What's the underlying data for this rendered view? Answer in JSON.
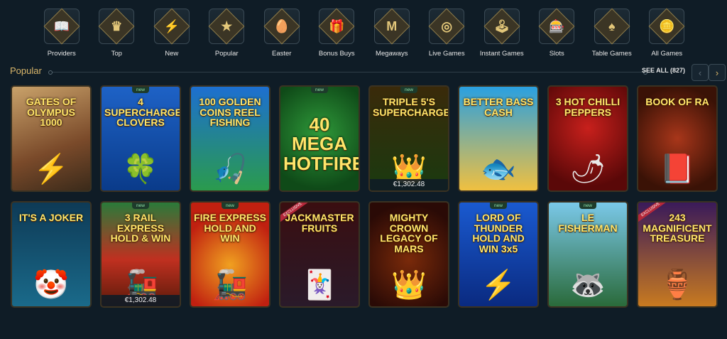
{
  "categories": [
    {
      "label": "Providers",
      "glyph": "📖"
    },
    {
      "label": "Top",
      "glyph": "♛"
    },
    {
      "label": "New",
      "glyph": "⚡"
    },
    {
      "label": "Popular",
      "glyph": "★"
    },
    {
      "label": "Easter",
      "glyph": "🥚"
    },
    {
      "label": "Bonus Buys",
      "glyph": "🎁"
    },
    {
      "label": "Megaways",
      "glyph": "M"
    },
    {
      "label": "Live Games",
      "glyph": "◎"
    },
    {
      "label": "Instant Games",
      "glyph": "🕹"
    },
    {
      "label": "Slots",
      "glyph": "🎰"
    },
    {
      "label": "Table Games",
      "glyph": "♠"
    },
    {
      "label": "All Games",
      "glyph": "🪙"
    }
  ],
  "section": {
    "title": "Popular",
    "see_all": "SEE ALL (827)",
    "prev_glyph": "‹",
    "next_glyph": "›"
  },
  "games_row1": [
    {
      "title": "GATES OF OLYMPUS 1000",
      "art": "⚡",
      "new": "",
      "jackpot": ""
    },
    {
      "title": "4 SUPERCHARGED CLOVERS",
      "art": "🍀",
      "new": "new",
      "jackpot": ""
    },
    {
      "title": "100 GOLDEN COINS REEL FISHING",
      "art": "🎣",
      "new": "",
      "jackpot": ""
    },
    {
      "title": "40 MEGA HOTFIRE",
      "art": "",
      "new": "new",
      "jackpot": ""
    },
    {
      "title": "TRIPLE 5'S SUPERCHARGED",
      "art": "👑",
      "new": "new",
      "jackpot": "€1,302.48"
    },
    {
      "title": "BETTER BASS CASH",
      "art": "🐟",
      "new": "",
      "jackpot": ""
    },
    {
      "title": "3 HOT CHILLI PEPPERS",
      "art": "🌶",
      "new": "",
      "jackpot": ""
    },
    {
      "title": "BOOK OF RA",
      "art": "📕",
      "new": "",
      "jackpot": ""
    }
  ],
  "games_row2": [
    {
      "title": "IT'S A JOKER",
      "art": "🤡",
      "new": "",
      "jackpot": "",
      "excl": ""
    },
    {
      "title": "3 RAIL EXPRESS HOLD & WIN",
      "art": "🚂",
      "new": "new",
      "jackpot": "€1,302.48",
      "excl": ""
    },
    {
      "title": "FIRE EXPRESS HOLD AND WIN",
      "art": "🚂",
      "new": "new",
      "jackpot": "",
      "excl": ""
    },
    {
      "title": "JACKMASTER FRUITS",
      "art": "🃏",
      "new": "",
      "jackpot": "",
      "excl": "EXCLUSIVE"
    },
    {
      "title": "MIGHTY CROWN LEGACY OF MARS",
      "art": "👑",
      "new": "",
      "jackpot": "",
      "excl": ""
    },
    {
      "title": "LORD OF THUNDER HOLD AND WIN 3x5",
      "art": "⚡",
      "new": "new",
      "jackpot": "",
      "excl": ""
    },
    {
      "title": "LE FISHERMAN",
      "art": "🦝",
      "new": "new",
      "jackpot": "",
      "excl": ""
    },
    {
      "title": "243 MAGNIFICENT TREASURE",
      "art": "🏺",
      "new": "",
      "jackpot": "",
      "excl": "EXCLUSIVE"
    }
  ]
}
